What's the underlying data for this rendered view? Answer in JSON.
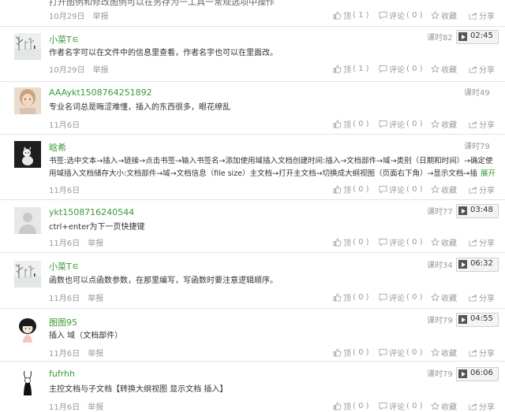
{
  "labels": {
    "up": "顶",
    "comment": "评论",
    "collect": "收藏",
    "share": "分享",
    "report": "举报"
  },
  "top_partial": {
    "text": "打开图例和修改图例可以在另存为一工具一常规选项中操作",
    "date": "10月29日",
    "up_count": "( 1 )",
    "comment_count": "( 0 )"
  },
  "comments": [
    {
      "user": "小菜Tㅌ",
      "text": "作者名字可以在文件中的信息里查看，作者名字也可以在里面改。",
      "date": "10月29日",
      "period": "课时82",
      "duration": "02:45",
      "up_count": "( 1 )",
      "comment_count": "( 0 )",
      "avatar": "snowy-trees"
    },
    {
      "user": "AAAykt1508764251892",
      "text": "专业名词总是晦涩难懂，插入的东西很多，眼花缭乱",
      "date": "11月6日",
      "period": "课时49",
      "duration": "",
      "up_count": "( 0 )",
      "comment_count": "( 0 )",
      "avatar": "girl-photo"
    },
    {
      "user": "晗希",
      "text": "书签:选中文本→插入→链接→点击书签→输入书签名→添加使用域插入文档创建时间:插入→文档部件→域→类别（日期和时间）→确定使用域插入文档储存大小:文档部件→域→文档信息（file size）主文档→打开主文档→切换成大纲视图（页面右下角）→显示文档→插",
      "expand": "展开",
      "date": "11月6日",
      "period": "课时79",
      "duration": "",
      "up_count": "( 0 )",
      "comment_count": "( 0 )",
      "avatar": "dark-cat"
    },
    {
      "user": "ykt1508716240544",
      "text": "ctrl+enter为下一页快捷键",
      "date": "11月6日",
      "period": "课时77",
      "duration": "03:48",
      "up_count": "( 0 )",
      "comment_count": "( 0 )",
      "avatar": "default-person"
    },
    {
      "user": "小菜Tㅌ",
      "text": "函数也可以点函数参数，在那里编写，写函数时要注意逻辑顺序。",
      "date": "11月6日",
      "period": "课时34",
      "duration": "06:32",
      "up_count": "( 0 )",
      "comment_count": "( 0 )",
      "avatar": "snowy-trees"
    },
    {
      "user": "图图95",
      "text": "插入   域（文档部件）",
      "date": "11月6日",
      "period": "课时79",
      "duration": "04:55",
      "up_count": "( 0 )",
      "comment_count": "( 0 )",
      "avatar": "cartoon-girl"
    },
    {
      "user": "fufrhh",
      "text": "主控文档与子文档【转换大纲视图 显示文档 插入】",
      "date": "11月6日",
      "period": "课时79",
      "duration": "06:06",
      "up_count": "( 0 )",
      "comment_count": "( 0 )",
      "avatar": "rabbit-sketch"
    }
  ]
}
